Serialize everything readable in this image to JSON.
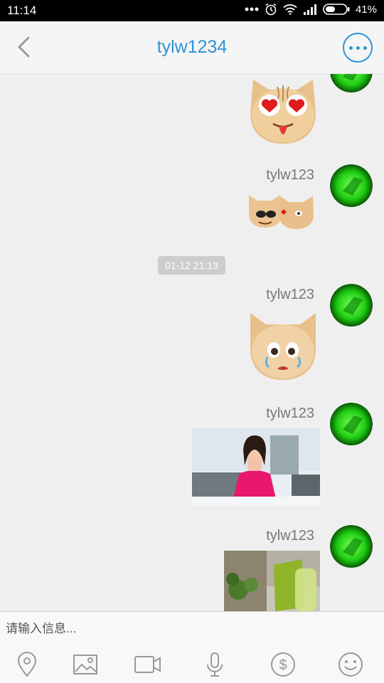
{
  "status_bar": {
    "time": "11:14",
    "battery": "41%"
  },
  "header": {
    "title": "tylw1234",
    "back_icon": "chevron-left-icon",
    "menu_icon": "more-dots-icon"
  },
  "messages": [
    {
      "sender": "",
      "type": "emoji",
      "emoji": "heart-eyes-cat-emoji"
    },
    {
      "sender": "tylw123",
      "type": "emoji",
      "emoji": "sunglasses-cats-emoji"
    },
    {
      "type": "timestamp",
      "text": "01-12 21:13"
    },
    {
      "sender": "tylw123",
      "type": "emoji",
      "emoji": "crying-cat-emoji"
    },
    {
      "sender": "tylw123",
      "type": "image",
      "image": "woman-blowing-kiss-photo"
    },
    {
      "sender": "tylw123",
      "type": "image",
      "image": "desk-plant-photo"
    }
  ],
  "input": {
    "placeholder": "请输入信息..."
  },
  "toolbar": [
    "location-icon",
    "image-icon",
    "video-icon",
    "microphone-icon",
    "money-icon",
    "smiley-icon"
  ],
  "colors": {
    "accent": "#2b95d6",
    "avatar_green": "#1ecb12"
  }
}
